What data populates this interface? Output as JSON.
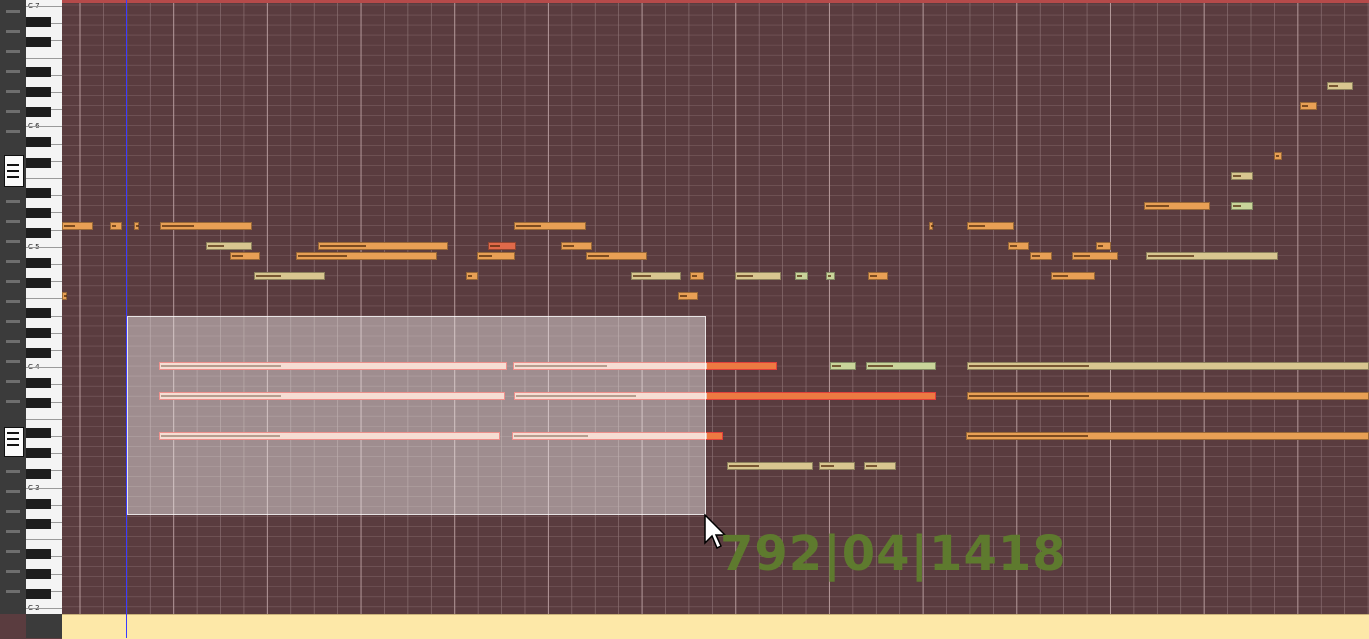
{
  "app": {
    "window": "MIDI piano roll editor"
  },
  "keyboard": {
    "octave_labels": [
      "C 7",
      "C 6",
      "C 5",
      "C 4",
      "C 3",
      "C 2"
    ]
  },
  "position_readout": "792|04|1418",
  "icons": {
    "cursor": "arrow-pointer-icon",
    "scroll_thumb": "scroll-grip-icon"
  },
  "colors": {
    "background": "#5a3c3f",
    "grid_line": "#7a5e60",
    "note_orange": "#e8a055",
    "note_pale": "#d8c690",
    "note_green": "#c9d49a",
    "note_selected": "#f0c4b4",
    "note_selected_border": "#e0403a",
    "readout": "#5e7a2e",
    "timeline": "#fde8a8",
    "playhead": "#3a3aff"
  }
}
